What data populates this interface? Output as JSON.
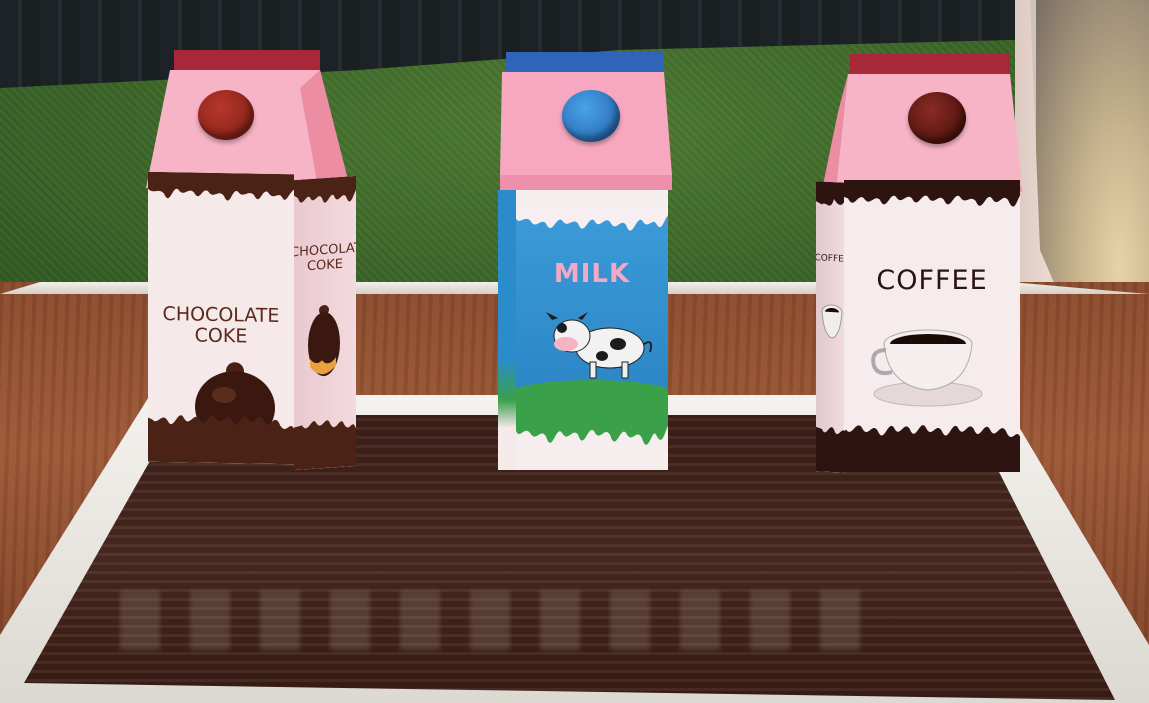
{
  "scene": {
    "colors": {
      "carton_pink": "#f5a7b8",
      "chocolate": "#4a2216",
      "milk_blue": "#2b8ccc",
      "grass_green": "#3f6a2a",
      "cap_brown": "#8a2318",
      "cap_blue": "#2f7ec9",
      "cap_dark": "#5b1410"
    }
  },
  "cartons": [
    {
      "id": "chocolate-coke",
      "front_label": [
        "CHOCOLATE",
        "COKE"
      ],
      "side_label": [
        "CHOCOLATE",
        "COKE"
      ],
      "icon": "cake-icon"
    },
    {
      "id": "milk",
      "front_label": [
        "MILK"
      ],
      "icon": "cow-icon"
    },
    {
      "id": "coffee",
      "front_label": [
        "COFFEE"
      ],
      "side_label": [
        "COFFEE"
      ],
      "icon": "coffee-cup-icon"
    }
  ]
}
